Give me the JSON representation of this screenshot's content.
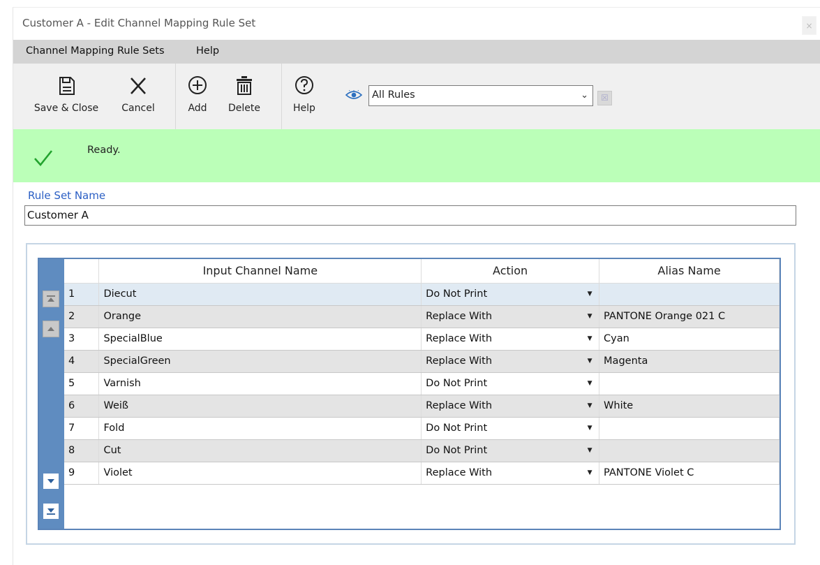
{
  "window": {
    "title": "Customer A - Edit Channel Mapping Rule Set",
    "close_glyph": "×"
  },
  "menu": [
    "Channel Mapping Rule Sets",
    "Help"
  ],
  "toolbar": {
    "save_close": "Save & Close",
    "cancel": "Cancel",
    "add": "Add",
    "delete": "Delete",
    "help": "Help",
    "filter_value": "All Rules"
  },
  "status": {
    "text": "Ready.",
    "color": "#bbffb8",
    "check_color": "#22a32e"
  },
  "rule_set": {
    "label": "Rule Set Name",
    "value": "Customer A"
  },
  "grid": {
    "columns": [
      "",
      "Input Channel Name",
      "Action",
      "Alias Name"
    ],
    "rows": [
      {
        "num": "1",
        "input": "Diecut",
        "action": "Do Not Print",
        "alias": ""
      },
      {
        "num": "2",
        "input": "Orange",
        "action": "Replace With",
        "alias": "PANTONE Orange 021 C"
      },
      {
        "num": "3",
        "input": "SpecialBlue",
        "action": "Replace With",
        "alias": "Cyan"
      },
      {
        "num": "4",
        "input": "SpecialGreen",
        "action": "Replace With",
        "alias": "Magenta"
      },
      {
        "num": "5",
        "input": "Varnish",
        "action": "Do Not Print",
        "alias": ""
      },
      {
        "num": "6",
        "input": "Weiß",
        "action": "Replace With",
        "alias": "White"
      },
      {
        "num": "7",
        "input": "Fold",
        "action": "Do Not Print",
        "alias": ""
      },
      {
        "num": "8",
        "input": "Cut",
        "action": "Do Not Print",
        "alias": ""
      },
      {
        "num": "9",
        "input": "Violet",
        "action": "Replace With",
        "alias": "PANTONE Violet C"
      }
    ],
    "selected_row": 0
  }
}
